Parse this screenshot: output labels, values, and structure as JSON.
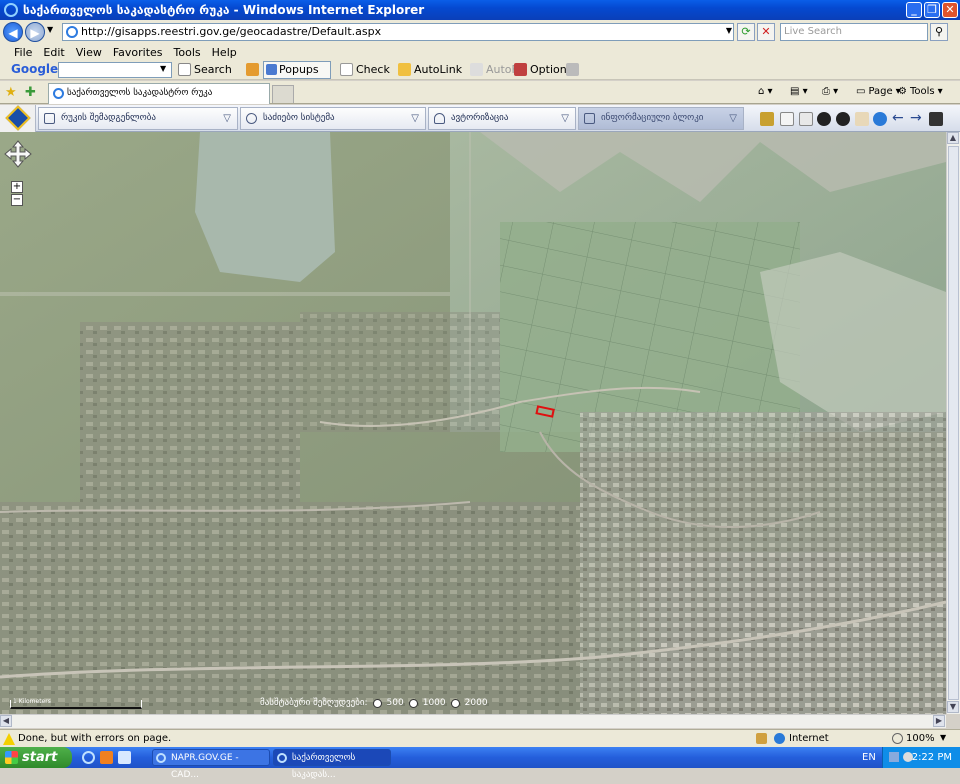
{
  "window": {
    "title": "საქართველოს საკადასტრო რუკა - Windows Internet Explorer",
    "minimize": "_",
    "restore": "❐",
    "close": "✕"
  },
  "address_bar": {
    "back": "◀",
    "forward": "▶",
    "url": "http://gisapps.reestri.gov.ge/geocadastre/Default.aspx",
    "live_search_placeholder": "Live Search"
  },
  "menu": [
    "File",
    "Edit",
    "View",
    "Favorites",
    "Tools",
    "Help"
  ],
  "google_toolbar": {
    "logo": "Google",
    "search_label": "Search",
    "popups_label": "Popups okay",
    "check_label": "Check",
    "autolink_label": "AutoLink",
    "autofill_label": "AutoFill",
    "options_label": "Options"
  },
  "tabs": {
    "active_tab_label": "საქართველოს საკადასტრო რუკა"
  },
  "ie_tools": {
    "page_label": "Page",
    "tools_label": "Tools"
  },
  "app_toolbar": {
    "tabs": [
      {
        "label": "რუკის შემადგენლობა"
      },
      {
        "label": "საძიებო სისტემა"
      },
      {
        "label": "ავტორიზაცია"
      },
      {
        "label": "ინფორმაციული ბლოკი"
      }
    ]
  },
  "map": {
    "scale_label": "1 Kilometers",
    "scale_selector_label": "მასშტაბური შეზღუდვები:",
    "scale_options": [
      "500",
      "1000",
      "2000"
    ],
    "zoom_in": "+",
    "zoom_out": "−"
  },
  "status_bar": {
    "message": "Done, but with errors on page.",
    "zone": "Internet",
    "zoom": "100%"
  },
  "taskbar": {
    "start": "start",
    "tasks": [
      "NAPR.GOV.GE - CAD...",
      "საქართველოს საკადას..."
    ],
    "language": "EN",
    "clock": "2:22 PM"
  }
}
